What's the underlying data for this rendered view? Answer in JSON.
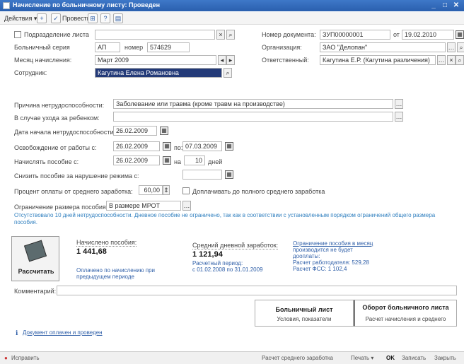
{
  "window": {
    "title": "Начисление по больничному листу: Проведен",
    "min_glyph": "_",
    "max_glyph": "□",
    "close_glyph": "✕"
  },
  "toolbar": {
    "actions_label": "Действия ▾",
    "post_label": "Провести",
    "help_glyph": "?",
    "icons": [
      "add-icon",
      "post-icon",
      "structure-icon",
      "help-icon",
      "print-icon"
    ]
  },
  "form": {
    "replacing_label": "Подразделение листа",
    "doc_number_label": "Номер документа:",
    "doc_number_value": "ЗУП00000001",
    "from_label": "от",
    "doc_date_value": "19.02.2010",
    "series_label": "Больничный серия",
    "series_value": "АП",
    "number_label": "номер",
    "number_value": "574629",
    "org_label": "Организация:",
    "org_value": "ЗАО \"Делопан\"",
    "month_label": "Месяц начисления:",
    "month_value": "Март 2009",
    "responsible_label": "Ответственный:",
    "responsible_value": "Кагутина Е.Р. (Кагутина различения)",
    "employee_label": "Сотрудник:",
    "employee_value": "Кагутина Елена Романовна",
    "cause_label": "Причина нетрудоспособности:",
    "cause_value": "Заболевание или травма (кроме травм на производстве)",
    "childcare_label": "В случае ухода за ребенком:",
    "start_label": "Дата начала нетрудоспособности:",
    "start_value": "26.02.2009",
    "release_label": "Освобождение от работы с:",
    "release_from": "26.02.2009",
    "release_to_label": "по:",
    "release_to": "07.03.2009",
    "pay_from_label": "Начислять пособие с:",
    "pay_from": "26.02.2009",
    "pay_for_label": "на",
    "pay_days": "10",
    "pay_days_unit": "дней",
    "reduce_label": "Снизить пособие за нарушение режима с:",
    "percent_label": "Процент оплаты от среднего заработка:",
    "percent_value": "60,00",
    "topup_label": "Доплачивать до полного среднего заработка",
    "limit_label": "Ограничение размера пособия:",
    "limit_value": "В размере МРОТ",
    "info_text": "Отсутствовало 10 дней нетрудоспособности. Дневное пособие не ограничено, так как в соответствии с установленным порядком ограничений общего размера пособия."
  },
  "results": {
    "calc_button": "Рассчитать",
    "accrued_label": "Начислено пособия:",
    "accrued_value": "1 441,68",
    "accrued_link": "Оплачено по начислению при предыдущем периоде",
    "avg_label": "Средний дневной заработок:",
    "avg_value": "1 121,94",
    "avg_period": "Расчетный период:",
    "avg_period_dates": "с 01.02.2008 по 31.01.2009",
    "limit_link": "Ограничение пособия в месяц",
    "limit_detail": "производится не будет",
    "limit_line2": "дооплаты:",
    "limit_line3": "Расчет работодателя: 529,28",
    "limit_line4": "Расчет ФСС: 1 102,4",
    "comment_label": "Комментарий:"
  },
  "boxes": {
    "sick_title": "Больничный лист",
    "sick_sub": "Условия, показатели",
    "reverse_title": "Оборот больничного листа",
    "reverse_sub": "Расчет начисления и среднего"
  },
  "footer_link": "Документ оплачен и проведен",
  "status": {
    "left": "Исправить",
    "avg_calc": "Расчет среднего заработка",
    "print": "Печать ▾",
    "ok": "OK",
    "write": "Записать",
    "close": "Закрыть"
  }
}
